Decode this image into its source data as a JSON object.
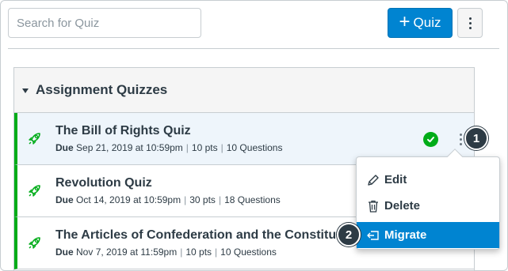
{
  "search": {
    "placeholder": "Search for Quiz"
  },
  "toolbar": {
    "add_quiz_label": "Quiz",
    "add_quiz_icon": "plus-icon",
    "options_icon": "kebab-icon"
  },
  "group": {
    "title": "Assignment Quizzes",
    "quizzes": [
      {
        "title": "The Bill of Rights Quiz",
        "due_label": "Due",
        "due": "Sep 21, 2019 at 10:59pm",
        "points": "10 pts",
        "questions": "10 Questions",
        "published": true
      },
      {
        "title": "Revolution Quiz",
        "due_label": "Due",
        "due": "Oct 14, 2019 at 10:59pm",
        "points": "30 pts",
        "questions": "18 Questions"
      },
      {
        "title": "The Articles of Confederation and the Constitution",
        "due_label": "Due",
        "due": "Nov 7, 2019 at 11:59pm",
        "points": "10 pts",
        "questions": "10 Questions"
      }
    ]
  },
  "menu": {
    "items": [
      {
        "label": "Edit",
        "icon": "pencil-icon"
      },
      {
        "label": "Delete",
        "icon": "trash-icon"
      },
      {
        "label": "Migrate",
        "icon": "migrate-icon"
      }
    ]
  },
  "callouts": [
    "1",
    "2"
  ],
  "colors": {
    "accent": "#0084d1",
    "published": "#00ac18",
    "text": "#2d3b45"
  }
}
